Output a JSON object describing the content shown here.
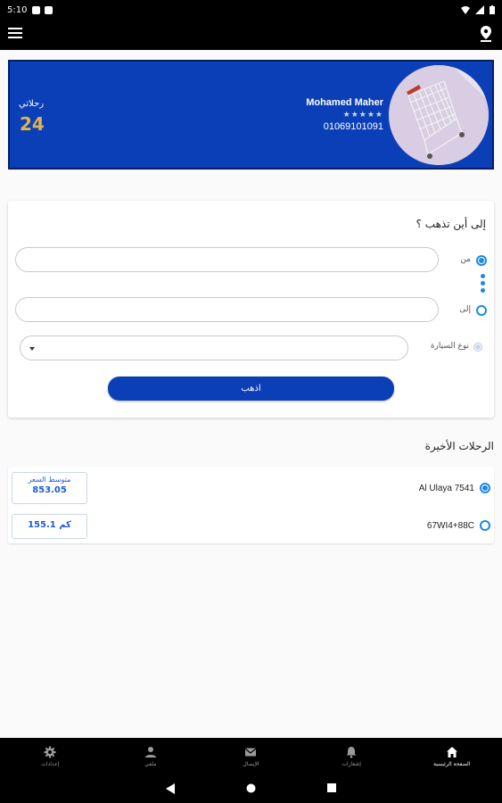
{
  "status_bar": {
    "time": "5:10"
  },
  "profile": {
    "name": "Mohamed Maher",
    "rating": "★★★★★",
    "phone": "01069101091",
    "trips_label": "رحلاتي",
    "trips_count": "24"
  },
  "trip_form": {
    "title": "إلى أين تذهب ؟",
    "from_label": "من",
    "to_label": "إلى",
    "from_value": "",
    "to_value": "",
    "car_type_label": "نوع السيارة",
    "car_type_value": "",
    "go_button": "اذهب"
  },
  "recent": {
    "title": "الرحلات الأخيرة",
    "trips": [
      {
        "address": "Al Ulaya 7541"
      },
      {
        "address": "67WI4+88C"
      }
    ],
    "avg_price_label": "متوسط السعر",
    "avg_price_value": "853.05",
    "distance_value": "155.1 كم"
  },
  "bottom_nav": {
    "items": [
      {
        "label": "إعدادات",
        "icon": "gear-icon"
      },
      {
        "label": "ملفي",
        "icon": "person-icon"
      },
      {
        "label": "الإيصال",
        "icon": "mail-icon"
      },
      {
        "label": "إشعارات",
        "icon": "bell-icon"
      },
      {
        "label": "الصفحة الرئيسية",
        "icon": "home-icon"
      }
    ]
  },
  "colors": {
    "primary": "#0b3fb8",
    "accent": "#1e88e5",
    "gold": "#e3b34a"
  }
}
